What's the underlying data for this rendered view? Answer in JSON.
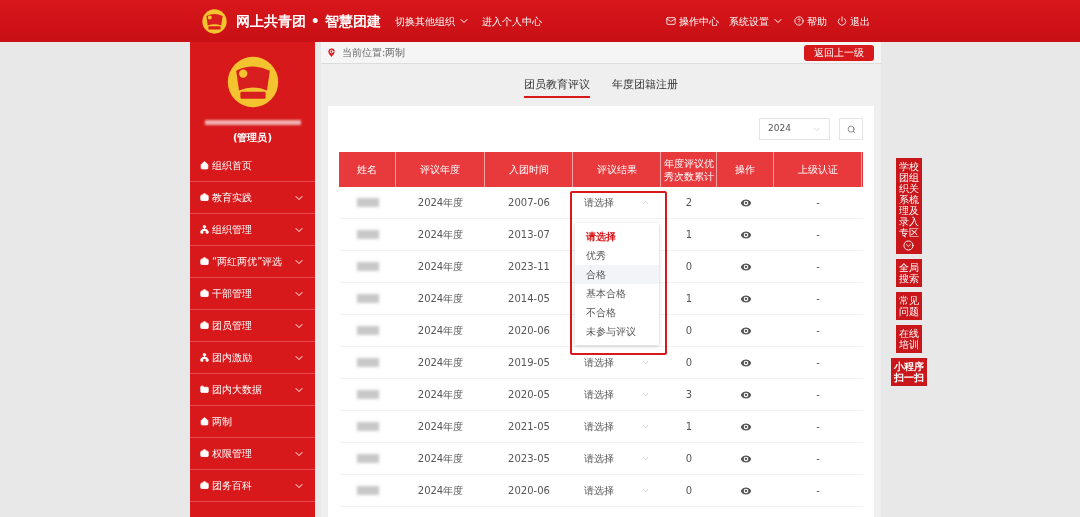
{
  "header": {
    "title": "网上共青团 • 智慧团建",
    "nav": [
      {
        "label": "切换其他组织",
        "dropdown": true
      },
      {
        "label": "进入个人中心",
        "dropdown": false
      }
    ],
    "actions": [
      {
        "label": "操作中心",
        "kind": "mail",
        "dropdown": false
      },
      {
        "label": "系统设置",
        "kind": "none",
        "dropdown": true
      },
      {
        "label": "帮助",
        "kind": "help",
        "dropdown": false
      },
      {
        "label": "退出",
        "kind": "power",
        "dropdown": false
      }
    ]
  },
  "sidebar": {
    "role": "(管理员)",
    "items": [
      {
        "label": "组织首页",
        "has_submenu": false
      },
      {
        "label": "教育实践",
        "has_submenu": true
      },
      {
        "label": "组织管理",
        "has_submenu": true
      },
      {
        "label": "“两红两优”评选",
        "has_submenu": true
      },
      {
        "label": "干部管理",
        "has_submenu": true
      },
      {
        "label": "团员管理",
        "has_submenu": true
      },
      {
        "label": "团内激励",
        "has_submenu": true
      },
      {
        "label": "团内大数据",
        "has_submenu": true
      },
      {
        "label": "两制",
        "has_submenu": false
      },
      {
        "label": "权限管理",
        "has_submenu": true
      },
      {
        "label": "团务百科",
        "has_submenu": true
      }
    ]
  },
  "breadcrumb": "当前位置:两制",
  "back_button": "返回上一级",
  "tabs": [
    {
      "label": "团员教育评议",
      "selected": true
    },
    {
      "label": "年度团籍注册",
      "selected": false
    }
  ],
  "year_select": {
    "value": "2024"
  },
  "table": {
    "columns": [
      "姓名",
      "评议年度",
      "入团时间",
      "评议结果",
      "年度评议优秀次数累计",
      "操作",
      "上级认证"
    ],
    "rows": [
      {
        "year": "2024年度",
        "joined": "2007-06",
        "result": "请选择",
        "count": "2",
        "cert": "-"
      },
      {
        "year": "2024年度",
        "joined": "2013-07",
        "count": "1",
        "cert": "-"
      },
      {
        "year": "2024年度",
        "joined": "2023-11",
        "count": "0",
        "cert": "-"
      },
      {
        "year": "2024年度",
        "joined": "2014-05",
        "count": "1",
        "cert": "-"
      },
      {
        "year": "2024年度",
        "joined": "2020-06",
        "count": "0",
        "cert": "-"
      },
      {
        "year": "2024年度",
        "joined": "2019-05",
        "result": "请选择",
        "count": "0",
        "cert": "-"
      },
      {
        "year": "2024年度",
        "joined": "2020-05",
        "result": "请选择",
        "count": "3",
        "cert": "-"
      },
      {
        "year": "2024年度",
        "joined": "2021-05",
        "result": "请选择",
        "count": "1",
        "cert": "-"
      },
      {
        "year": "2024年度",
        "joined": "2023-05",
        "result": "请选择",
        "count": "0",
        "cert": "-"
      },
      {
        "year": "2024年度",
        "joined": "2020-06",
        "result": "请选择",
        "count": "0",
        "cert": "-"
      }
    ]
  },
  "dropdown": {
    "options": [
      {
        "label": "请选择",
        "selected": true,
        "highlighted": false
      },
      {
        "label": "优秀",
        "selected": false,
        "highlighted": false
      },
      {
        "label": "合格",
        "selected": false,
        "highlighted": true
      },
      {
        "label": "基本合格",
        "selected": false,
        "highlighted": false
      },
      {
        "label": "不合格",
        "selected": false,
        "highlighted": false
      },
      {
        "label": "未参与评议",
        "selected": false,
        "highlighted": false
      }
    ]
  },
  "float_panel": [
    {
      "label": "学校团组织关系梳理及录入专区",
      "kind": "expand"
    },
    {
      "label": "全局搜索",
      "kind": "plain"
    },
    {
      "label": "常见问题",
      "kind": "plain"
    },
    {
      "label": "在线培训",
      "kind": "plain"
    },
    {
      "label": "小程序扫一扫",
      "kind": "small"
    }
  ]
}
